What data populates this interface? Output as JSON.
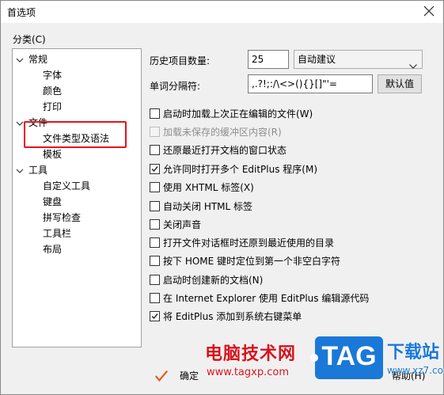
{
  "window": {
    "title": "首选项"
  },
  "categories": {
    "label": "分类(C)",
    "items": [
      {
        "label": "常规"
      },
      {
        "label": "字体"
      },
      {
        "label": "颜色"
      },
      {
        "label": "打印"
      },
      {
        "label": "文件"
      },
      {
        "label": "文件类型及语法"
      },
      {
        "label": "模板"
      },
      {
        "label": "工具"
      },
      {
        "label": "自定义工具"
      },
      {
        "label": "键盘"
      },
      {
        "label": "拼写检查"
      },
      {
        "label": "工具栏"
      },
      {
        "label": "布局"
      }
    ]
  },
  "history": {
    "label": "历史项目数量:",
    "value": "25",
    "mode": "自动建议"
  },
  "delimiter": {
    "label": "单词分隔符:",
    "value": ",.?!;:/\\<>(){}[]\"'=",
    "default_button": "默认值"
  },
  "options": [
    {
      "label": "启动时加载上次正在编辑的文件(W)",
      "checked": false,
      "enabled": true
    },
    {
      "label": "加载未保存的缓冲区内容(R)",
      "checked": false,
      "enabled": false
    },
    {
      "label": "还原最近打开文档的窗口状态",
      "checked": false,
      "enabled": true
    },
    {
      "label": "允许同时打开多个 EditPlus 程序(M)",
      "checked": true,
      "enabled": true
    },
    {
      "label": "使用 XHTML 标签(X)",
      "checked": false,
      "enabled": true
    },
    {
      "label": "自动关闭 HTML 标签",
      "checked": false,
      "enabled": true
    },
    {
      "label": "关闭声音",
      "checked": false,
      "enabled": true
    },
    {
      "label": "打开文件对话框时还原到最近使用的目录",
      "checked": false,
      "enabled": true
    },
    {
      "label": "按下 HOME 键时定位到第一个非空白字符",
      "checked": false,
      "enabled": true
    },
    {
      "label": "启动时创建新的文档(N)",
      "checked": false,
      "enabled": true
    },
    {
      "label": "在 Internet Explorer 使用 EditPlus 编辑源代码",
      "checked": false,
      "enabled": true
    },
    {
      "label": "将 EditPlus 添加到系统右键菜单",
      "checked": true,
      "enabled": true
    }
  ],
  "footer": {
    "ok": "确定",
    "help": "帮助(H)"
  },
  "watermark": {
    "site_name": "电脑技术网",
    "site_url": "www.tagxp.com",
    "logo": "TAG",
    "logo_sub": "下载站",
    "logo_url": "www.xz7.com"
  },
  "colors": {
    "highlight": "#e8121c",
    "logo_blue": "#1a78d8",
    "watermark_red": "#d8121c"
  }
}
